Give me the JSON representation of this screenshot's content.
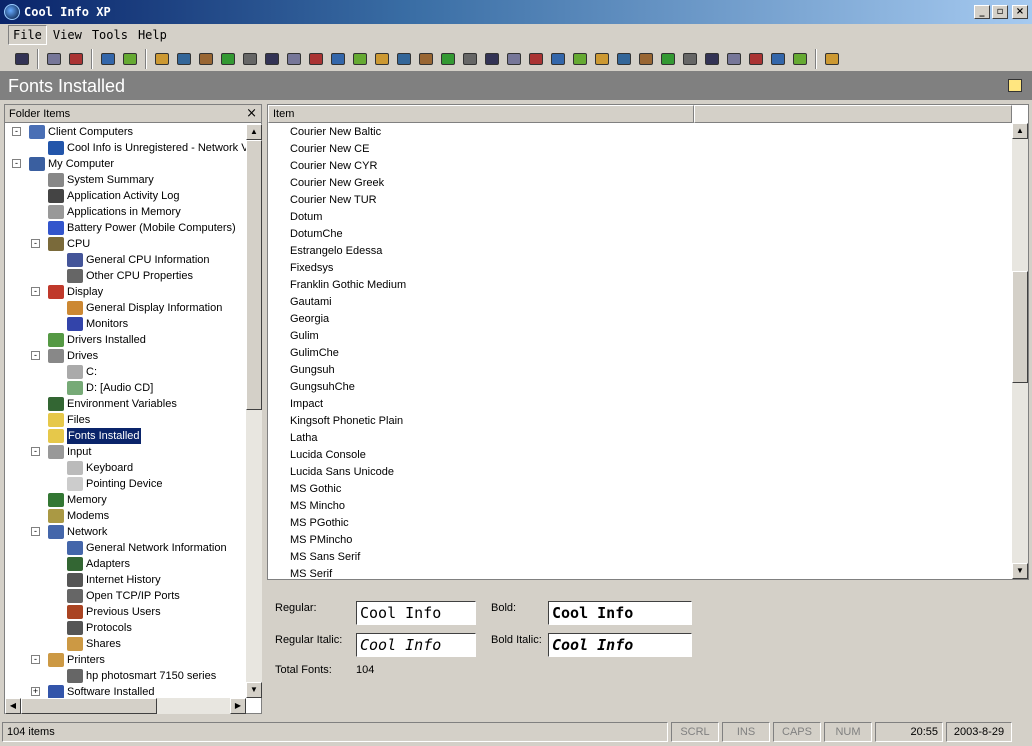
{
  "window": {
    "title": "Cool Info XP",
    "minimize": "_",
    "restore": "▫",
    "close": "×"
  },
  "menu": [
    "File",
    "View",
    "Tools",
    "Help"
  ],
  "header": {
    "title": "Fonts Installed"
  },
  "folder_pane": {
    "title": "Folder Items",
    "close": "×",
    "tree": [
      {
        "label": "Client Computers",
        "level": 0,
        "exp": "-",
        "color": "#4a6fb5"
      },
      {
        "label": "Cool Info is Unregistered - Network V",
        "level": 1,
        "color": "#2255aa"
      },
      {
        "label": "My Computer",
        "level": 0,
        "exp": "-",
        "color": "#3a5fa0"
      },
      {
        "label": "System Summary",
        "level": 1,
        "color": "#888"
      },
      {
        "label": "Application Activity Log",
        "level": 1,
        "color": "#444"
      },
      {
        "label": "Applications in Memory",
        "level": 1,
        "color": "#999"
      },
      {
        "label": "Battery Power (Mobile Computers)",
        "level": 1,
        "color": "#3355cc"
      },
      {
        "label": "CPU",
        "level": 1,
        "exp": "-",
        "color": "#7a6a3a"
      },
      {
        "label": "General CPU Information",
        "level": 2,
        "color": "#445599"
      },
      {
        "label": "Other CPU Properties",
        "level": 2,
        "color": "#666"
      },
      {
        "label": "Display",
        "level": 1,
        "exp": "-",
        "color": "#c0392b"
      },
      {
        "label": "General Display Information",
        "level": 2,
        "color": "#cc8833"
      },
      {
        "label": "Monitors",
        "level": 2,
        "color": "#3344aa"
      },
      {
        "label": "Drivers Installed",
        "level": 1,
        "color": "#559944"
      },
      {
        "label": "Drives",
        "level": 1,
        "exp": "-",
        "color": "#888"
      },
      {
        "label": "C:",
        "level": 2,
        "color": "#aaa"
      },
      {
        "label": "D: [Audio CD]",
        "level": 2,
        "color": "#77aa77"
      },
      {
        "label": "Environment Variables",
        "level": 1,
        "color": "#336633"
      },
      {
        "label": "Files",
        "level": 1,
        "color": "#e6c84a"
      },
      {
        "label": "Fonts Installed",
        "level": 1,
        "color": "#e6c84a",
        "selected": true
      },
      {
        "label": "Input",
        "level": 1,
        "exp": "-",
        "color": "#999"
      },
      {
        "label": "Keyboard",
        "level": 2,
        "color": "#bbb"
      },
      {
        "label": "Pointing Device",
        "level": 2,
        "color": "#ccc"
      },
      {
        "label": "Memory",
        "level": 1,
        "color": "#337733"
      },
      {
        "label": "Modems",
        "level": 1,
        "color": "#aa9944"
      },
      {
        "label": "Network",
        "level": 1,
        "exp": "-",
        "color": "#4466aa"
      },
      {
        "label": "General Network Information",
        "level": 2,
        "color": "#4466aa"
      },
      {
        "label": "Adapters",
        "level": 2,
        "color": "#336633"
      },
      {
        "label": "Internet History",
        "level": 2,
        "color": "#555"
      },
      {
        "label": "Open TCP/IP Ports",
        "level": 2,
        "color": "#666"
      },
      {
        "label": "Previous Users",
        "level": 2,
        "color": "#aa4422"
      },
      {
        "label": "Protocols",
        "level": 2,
        "color": "#555"
      },
      {
        "label": "Shares",
        "level": 2,
        "color": "#cc9944"
      },
      {
        "label": "Printers",
        "level": 1,
        "exp": "-",
        "color": "#cc9944"
      },
      {
        "label": "hp photosmart 7150 series",
        "level": 2,
        "color": "#666"
      },
      {
        "label": "Software Installed",
        "level": 1,
        "exp": "+",
        "color": "#3355aa"
      }
    ]
  },
  "list": {
    "columns": [
      "Item",
      ""
    ],
    "items": [
      "Courier New Baltic",
      "Courier New CE",
      "Courier New CYR",
      "Courier New Greek",
      "Courier New TUR",
      "Dotum",
      "DotumChe",
      "Estrangelo Edessa",
      "Fixedsys",
      "Franklin Gothic Medium",
      "Gautami",
      "Georgia",
      "Gulim",
      "GulimChe",
      "Gungsuh",
      "GungsuhChe",
      "Impact",
      "Kingsoft Phonetic Plain",
      "Latha",
      "Lucida Console",
      "Lucida Sans Unicode",
      "MS Gothic",
      "MS Mincho",
      "MS PGothic",
      "MS PMincho",
      "MS Sans Serif",
      "MS Serif"
    ]
  },
  "preview": {
    "regular_label": "Regular:",
    "regular_value": "Cool Info",
    "bold_label": "Bold:",
    "bold_value": "Cool Info",
    "italic_label": "Regular Italic:",
    "italic_value": "Cool Info",
    "bolditalic_label": "Bold Italic:",
    "bolditalic_value": "Cool Info",
    "total_label": "Total Fonts:",
    "total_value": "104"
  },
  "status": {
    "items": "104 items",
    "scrl": "SCRL",
    "ins": "INS",
    "caps": "CAPS",
    "num": "NUM",
    "time": "20:55",
    "date": "2003-8-29"
  }
}
